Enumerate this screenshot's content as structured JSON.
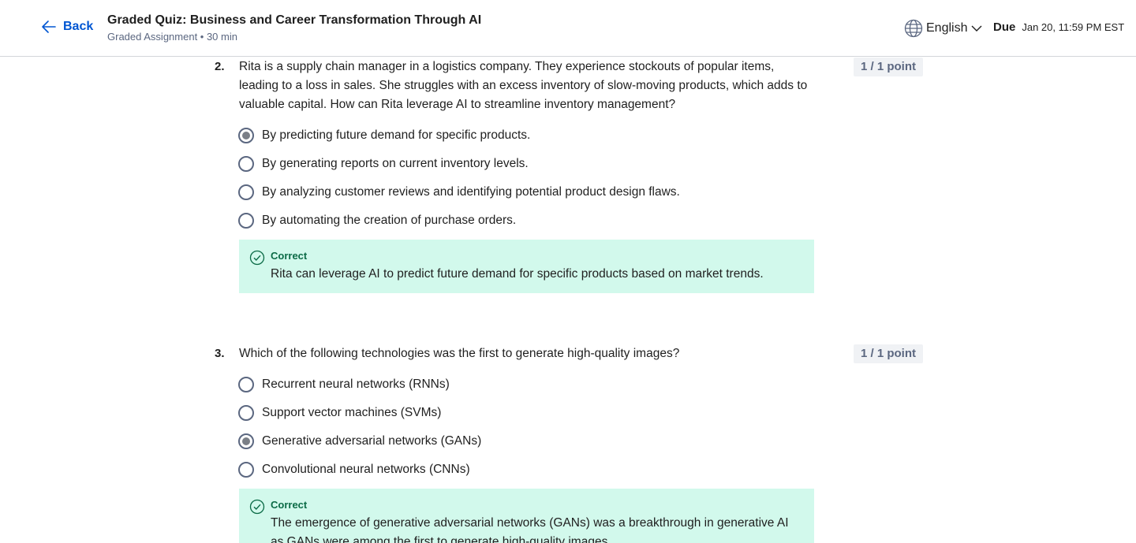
{
  "header": {
    "back_label": "Back",
    "title": "Graded Quiz: Business and Career Transformation Through AI",
    "subtitle": "Graded Assignment • 30 min",
    "language": "English",
    "due_label": "Due",
    "due_date": "Jan 20, 11:59 PM EST"
  },
  "questions": [
    {
      "number": "2.",
      "text": "Rita is a supply chain manager in a logistics company. They experience stockouts of popular items, leading to a loss in sales. She struggles with an excess inventory of slow-moving products, which adds to valuable capital. How can Rita leverage AI to streamline inventory management?",
      "points": "1 / 1 point",
      "options": [
        {
          "label": "By predicting future demand for specific products.",
          "selected": true
        },
        {
          "label": "By generating reports on current inventory levels.",
          "selected": false
        },
        {
          "label": "By analyzing customer reviews and identifying potential product design flaws.",
          "selected": false
        },
        {
          "label": "By automating the creation of purchase orders.",
          "selected": false
        }
      ],
      "feedback": {
        "status": "Correct",
        "text": "Rita can leverage AI to predict future demand for specific products based on market trends."
      }
    },
    {
      "number": "3.",
      "text": "Which of the following technologies was the first to generate high-quality images?",
      "points": "1 / 1 point",
      "options": [
        {
          "label": "Recurrent neural networks (RNNs)",
          "selected": false
        },
        {
          "label": "Support vector machines (SVMs)",
          "selected": false
        },
        {
          "label": "Generative adversarial networks (GANs)",
          "selected": true
        },
        {
          "label": "Convolutional neural networks (CNNs)",
          "selected": false
        }
      ],
      "feedback": {
        "status": "Correct",
        "text": "The emergence of generative adversarial networks (GANs) was a breakthrough in generative AI as GANs were among the first to generate high-quality images."
      }
    }
  ],
  "icons": {
    "back": "arrow-left-icon",
    "language": "globe-icon",
    "dropdown": "chevron-down-icon",
    "feedback": "check-circle-icon"
  },
  "colors": {
    "accent": "#0056d2",
    "correct_bg": "#d2f9ec",
    "correct_text": "#0b6b46"
  }
}
